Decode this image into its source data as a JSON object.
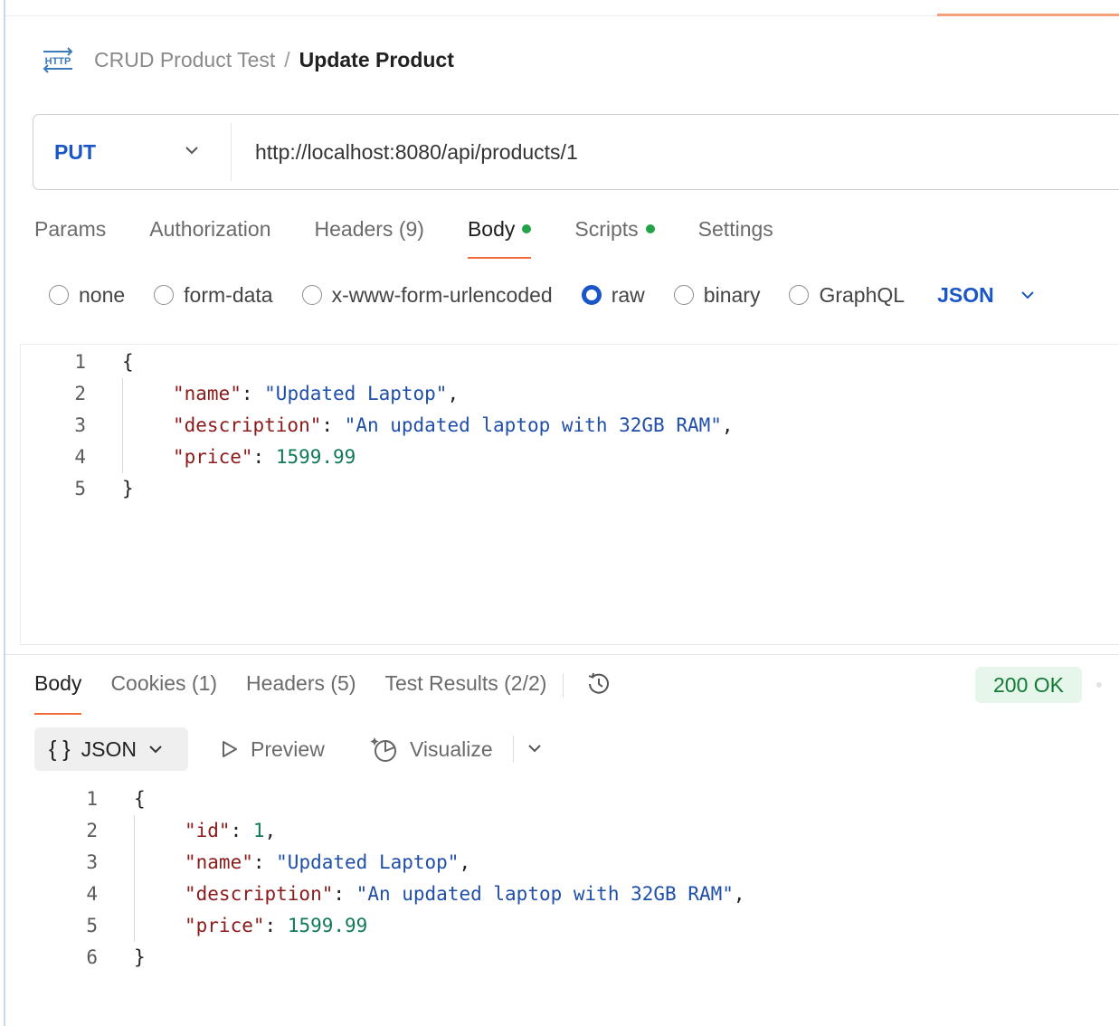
{
  "breadcrumb": {
    "icon": "http-request-icon",
    "icon_text": "HTTP",
    "collection": "CRUD Product Test",
    "separator": "/",
    "request": "Update Product"
  },
  "request": {
    "method": "PUT",
    "url": "http://localhost:8080/api/products/1"
  },
  "request_tabs": [
    {
      "label": "Params",
      "active": false,
      "dot": false
    },
    {
      "label": "Authorization",
      "active": false,
      "dot": false
    },
    {
      "label": "Headers (9)",
      "active": false,
      "dot": false
    },
    {
      "label": "Body",
      "active": true,
      "dot": true
    },
    {
      "label": "Scripts",
      "active": false,
      "dot": true
    },
    {
      "label": "Settings",
      "active": false,
      "dot": false
    }
  ],
  "body_types": [
    {
      "label": "none",
      "selected": false
    },
    {
      "label": "form-data",
      "selected": false
    },
    {
      "label": "x-www-form-urlencoded",
      "selected": false
    },
    {
      "label": "raw",
      "selected": true
    },
    {
      "label": "binary",
      "selected": false
    },
    {
      "label": "GraphQL",
      "selected": false
    }
  ],
  "body_language": "JSON",
  "request_body": {
    "line_numbers": [
      "1",
      "2",
      "3",
      "4",
      "5"
    ],
    "lines": [
      [
        {
          "t": "{",
          "c": "p"
        }
      ],
      [
        {
          "t": "\"name\"",
          "c": "k"
        },
        {
          "t": ": ",
          "c": "p"
        },
        {
          "t": "\"Updated Laptop\"",
          "c": "s"
        },
        {
          "t": ",",
          "c": "p"
        }
      ],
      [
        {
          "t": "\"description\"",
          "c": "k"
        },
        {
          "t": ": ",
          "c": "p"
        },
        {
          "t": "\"An updated laptop with 32GB RAM\"",
          "c": "s"
        },
        {
          "t": ",",
          "c": "p"
        }
      ],
      [
        {
          "t": "\"price\"",
          "c": "k"
        },
        {
          "t": ": ",
          "c": "p"
        },
        {
          "t": "1599.99",
          "c": "n"
        }
      ],
      [
        {
          "t": "}",
          "c": "p"
        }
      ]
    ]
  },
  "response_tabs": [
    {
      "label": "Body",
      "active": true
    },
    {
      "label": "Cookies (1)",
      "active": false
    },
    {
      "label": "Headers (5)",
      "active": false
    },
    {
      "label": "Test Results (2/2)",
      "active": false
    }
  ],
  "status": {
    "text": "200 OK",
    "color": "#137a36"
  },
  "response_toolbar": {
    "format_braces": "{ }",
    "format": "JSON",
    "preview": "Preview",
    "visualize": "Visualize"
  },
  "response_body": {
    "line_numbers": [
      "1",
      "2",
      "3",
      "4",
      "5",
      "6"
    ],
    "lines": [
      [
        {
          "t": "{",
          "c": "p"
        }
      ],
      [
        {
          "t": "\"id\"",
          "c": "k"
        },
        {
          "t": ": ",
          "c": "p"
        },
        {
          "t": "1",
          "c": "n"
        },
        {
          "t": ",",
          "c": "p"
        }
      ],
      [
        {
          "t": "\"name\"",
          "c": "k"
        },
        {
          "t": ": ",
          "c": "p"
        },
        {
          "t": "\"Updated Laptop\"",
          "c": "s"
        },
        {
          "t": ",",
          "c": "p"
        }
      ],
      [
        {
          "t": "\"description\"",
          "c": "k"
        },
        {
          "t": ": ",
          "c": "p"
        },
        {
          "t": "\"An updated laptop with 32GB RAM\"",
          "c": "s"
        },
        {
          "t": ",",
          "c": "p"
        }
      ],
      [
        {
          "t": "\"price\"",
          "c": "k"
        },
        {
          "t": ": ",
          "c": "p"
        },
        {
          "t": "1599.99",
          "c": "n"
        }
      ],
      [
        {
          "t": "}",
          "c": "p"
        }
      ]
    ]
  },
  "colors": {
    "accent": "#f26b3a",
    "method": "#1a56c7",
    "dot": "#22a348",
    "json_key": "#8b1a1a",
    "json_string": "#1f4fa8",
    "json_number": "#0f7a55"
  }
}
